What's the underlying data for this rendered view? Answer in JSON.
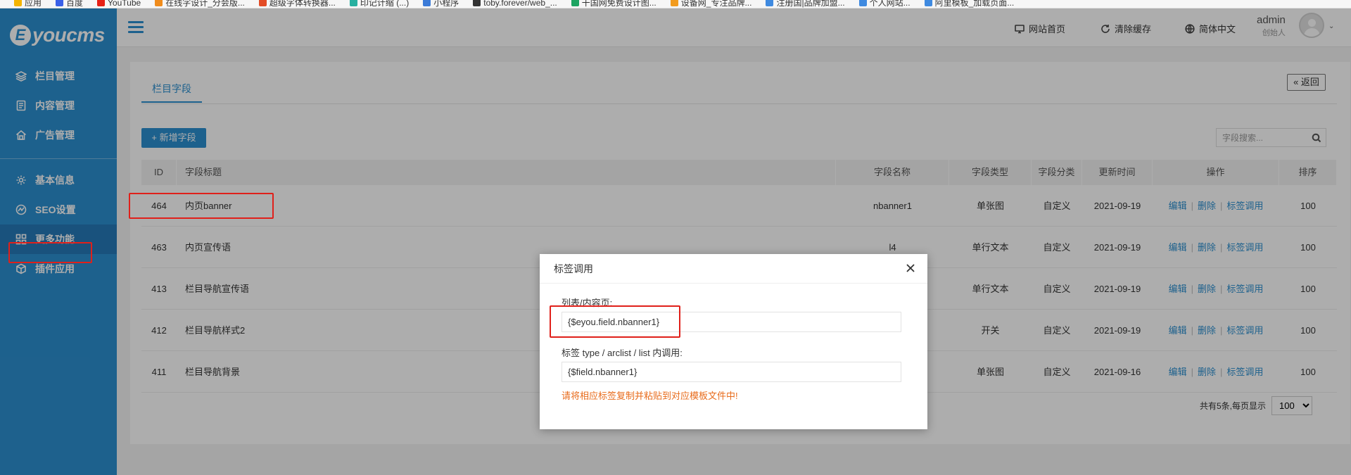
{
  "browser": {
    "bookmarks": [
      {
        "label": "应用",
        "color": "#f4b400"
      },
      {
        "label": "百度",
        "color": "#3a60e8"
      },
      {
        "label": "YouTube",
        "color": "#e62117"
      },
      {
        "label": "在线字设计_分会版...",
        "color": "#f08c1c"
      },
      {
        "label": "超级字体转换器...",
        "color": "#e34c26"
      },
      {
        "label": "印记计缩 (...)",
        "color": "#27b0a0"
      },
      {
        "label": "小程序",
        "color": "#3b7bd8"
      },
      {
        "label": "toby.forever/web_...",
        "color": "#333333"
      },
      {
        "label": "干国网免费设计图...",
        "color": "#1da462"
      },
      {
        "label": "设备网_专注品牌...",
        "color": "#f29b1d"
      },
      {
        "label": "注册国|品牌加盟...",
        "color": "#3f8ae0"
      },
      {
        "label": "个人网站...",
        "color": "#3f8ae0"
      },
      {
        "label": "阿里模板_加载页面...",
        "color": "#3f8ae0"
      }
    ]
  },
  "sidebar": {
    "logo_letter": "E",
    "logo_text": "youcms",
    "items": [
      {
        "label": "栏目管理",
        "icon": "layers-icon",
        "active": false
      },
      {
        "label": "内容管理",
        "icon": "document-icon",
        "active": false
      },
      {
        "label": "广告管理",
        "icon": "house-icon",
        "active": false
      },
      {
        "label": "基本信息",
        "icon": "gear-icon",
        "active": false
      },
      {
        "label": "SEO设置",
        "icon": "seo-icon",
        "active": false
      },
      {
        "label": "更多功能",
        "icon": "grid-icon",
        "active": true
      },
      {
        "label": "插件应用",
        "icon": "cube-icon",
        "active": false
      }
    ]
  },
  "header": {
    "links": [
      {
        "label": "网站首页",
        "icon": "monitor-icon"
      },
      {
        "label": "清除缓存",
        "icon": "refresh-icon"
      },
      {
        "label": "简体中文",
        "icon": "globe-icon"
      }
    ],
    "user_name": "admin",
    "user_role": "创始人"
  },
  "main": {
    "tab_label": "栏目字段",
    "back_label": "« 返回",
    "add_label": "+ 新增字段",
    "search_placeholder": "字段搜索...",
    "columns": [
      "ID",
      "字段标题",
      "字段名称",
      "字段类型",
      "字段分类",
      "更新时间",
      "操作",
      "排序"
    ],
    "rows": [
      {
        "id": "464",
        "title": "内页banner",
        "name": "nbanner1",
        "type": "单张图",
        "category": "自定义",
        "time": "2021-09-19",
        "sort": "100"
      },
      {
        "id": "463",
        "title": "内页宣传语",
        "name": "l4",
        "type": "单行文本",
        "category": "自定义",
        "time": "2021-09-19",
        "sort": "100"
      },
      {
        "id": "413",
        "title": "栏目导航宣传语",
        "name": "",
        "type": "单行文本",
        "category": "自定义",
        "time": "2021-09-19",
        "sort": "100"
      },
      {
        "id": "412",
        "title": "栏目导航样式2",
        "name": "",
        "type": "开关",
        "category": "自定义",
        "time": "2021-09-19",
        "sort": "100"
      },
      {
        "id": "411",
        "title": "栏目导航背景",
        "name": "",
        "type": "单张图",
        "category": "自定义",
        "time": "2021-09-16",
        "sort": "100"
      }
    ],
    "ops": {
      "edit": "编辑",
      "delete": "删除",
      "tag": "标签调用"
    },
    "pager_text": "共有5条,每页显示",
    "page_size": "100"
  },
  "modal": {
    "title": "标签调用",
    "label1": "列表/内容页:",
    "value1": "{$eyou.field.nbanner1}",
    "label2": "标签 type / arclist / list 内调用:",
    "value2": "{$field.nbanner1}",
    "note": "请将相应标签复制并粘贴到对应模板文件中!"
  },
  "colors": {
    "sidebar": "#2c8fd0",
    "sidebar_active": "#2579b8",
    "accent": "#2c8fd0",
    "highlight": "#e0201a",
    "note": "#e86b1b"
  }
}
